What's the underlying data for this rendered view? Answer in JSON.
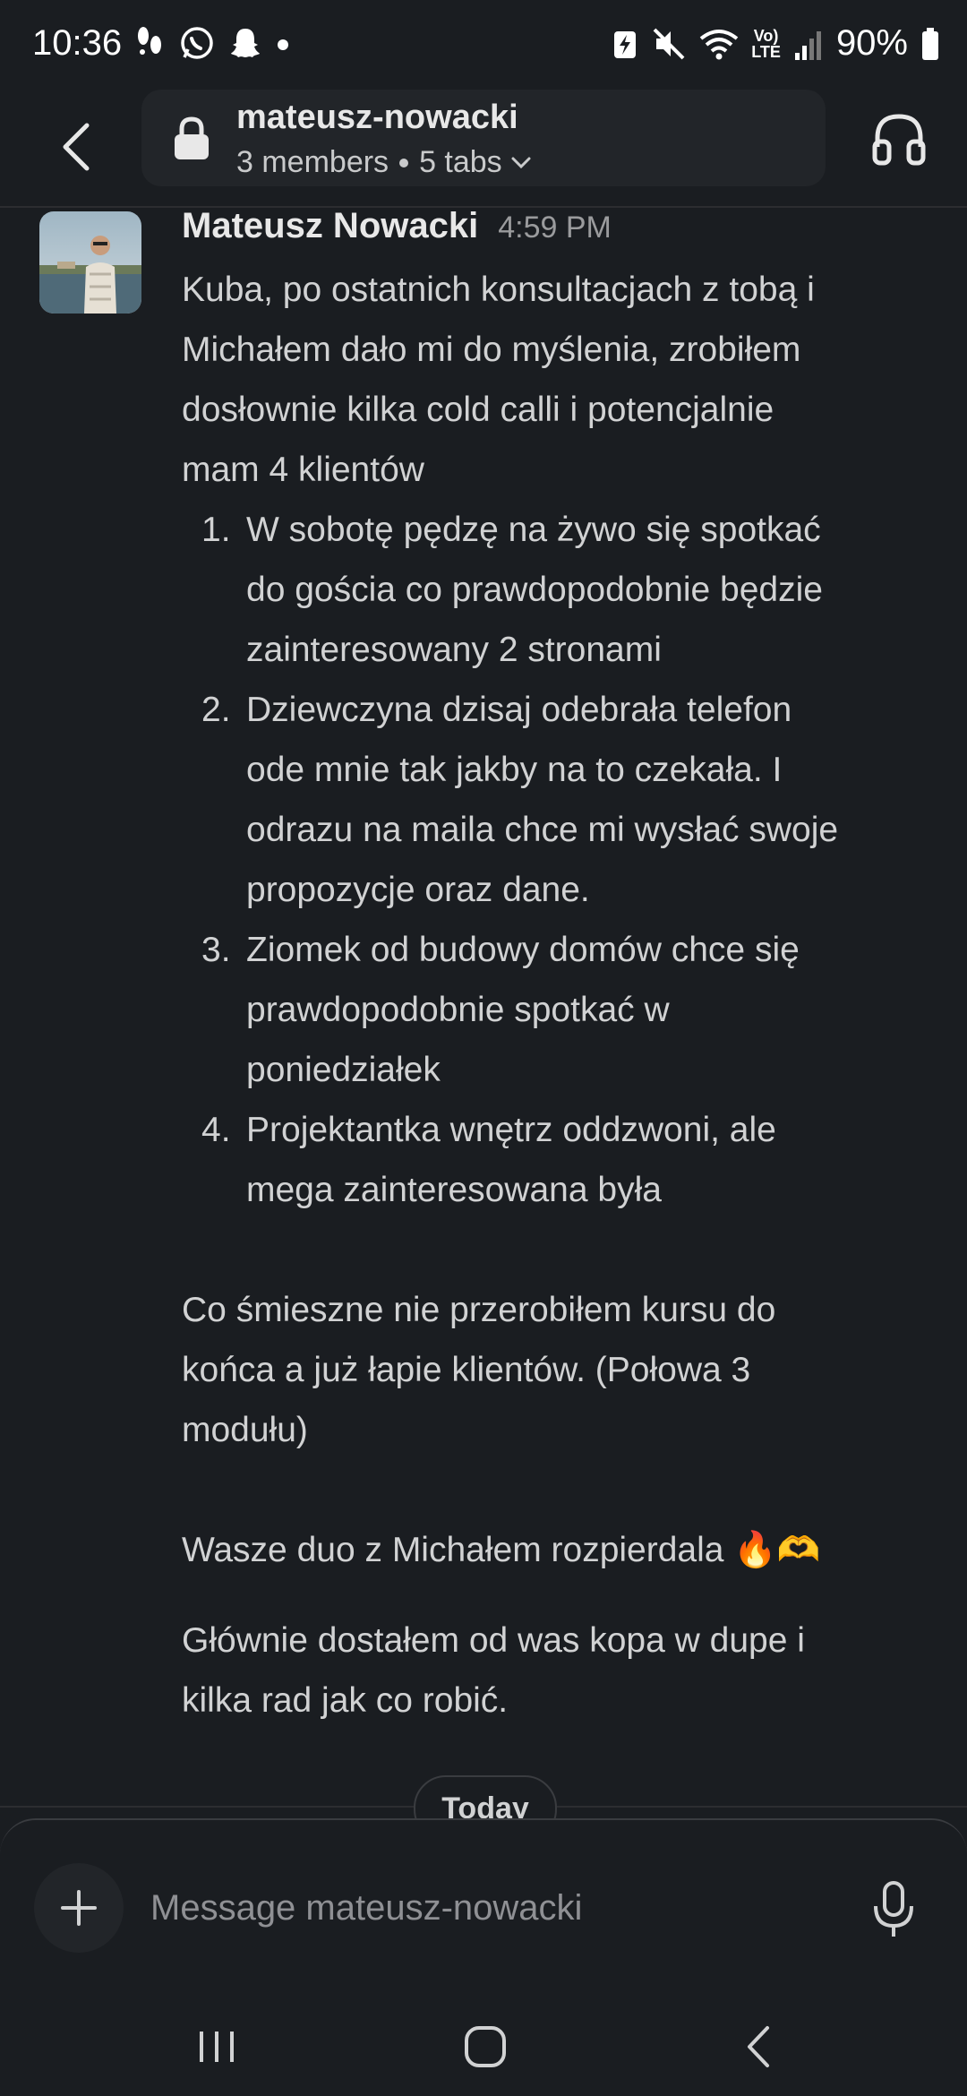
{
  "status_bar": {
    "time": "10:36",
    "battery": "90%",
    "network": "LTE",
    "volte": "Vo)"
  },
  "header": {
    "channel_name": "mateusz-nowacki",
    "members": "3 members",
    "tabs": "5 tabs"
  },
  "message": {
    "author": "Mateusz Nowacki",
    "time": "4:59 PM",
    "intro_lines": [
      "Kuba, po ostatnich konsultacjach z tobą i",
      "Michałem dało mi do myślenia, zrobiłem",
      "dosłownie kilka cold calli i potencjalnie",
      "mam 4 klientów"
    ],
    "list": [
      {
        "num": "1.",
        "lines": [
          "W sobotę pędzę na żywo się spotkać",
          "do gościa co prawdopodobnie będzie",
          "zainteresowany 2 stronami"
        ]
      },
      {
        "num": "2.",
        "lines": [
          "Dziewczyna dzisaj odebrała telefon",
          "ode mnie tak jakby na to czekała. I",
          "odrazu na maila chce mi wysłać swoje",
          "propozycje oraz dane."
        ]
      },
      {
        "num": "3.",
        "lines": [
          "Ziomek od budowy domów chce się",
          "prawdopodobnie spotkać w",
          "poniedziałek"
        ]
      },
      {
        "num": "4.",
        "lines": [
          "Projektantka wnętrz oddzwoni, ale",
          "mega zainteresowana była"
        ]
      }
    ],
    "para2_lines": [
      "Co śmieszne nie przerobiłem kursu do",
      "końca a już łapie klientów. (Połowa 3",
      "modułu)"
    ],
    "para3": "Wasze duo z Michałem rozpierdala 🔥🫶",
    "para4_lines": [
      "Głównie dostałem od was kopa w dupe i",
      "kilka rad jak co robić."
    ]
  },
  "divider": {
    "label": "Today"
  },
  "composer": {
    "placeholder": "Message mateusz-nowacki"
  },
  "icons": {
    "back": "chevron-left-icon",
    "lock": "lock-icon",
    "headphones": "headphones-icon",
    "plus": "plus-icon",
    "mic": "microphone-icon"
  }
}
